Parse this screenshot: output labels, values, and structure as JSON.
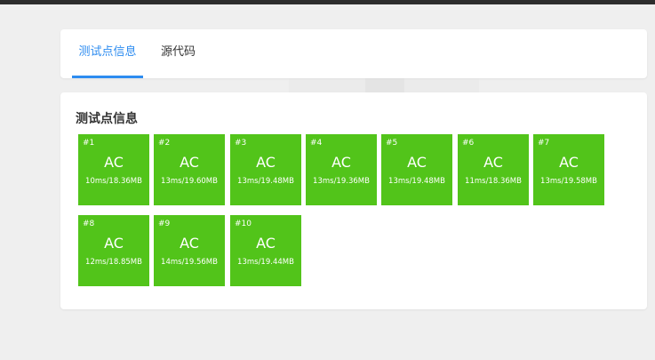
{
  "tabs": [
    {
      "label": "测试点信息",
      "active": true
    },
    {
      "label": "源代码",
      "active": false
    }
  ],
  "section": {
    "title": "测试点信息"
  },
  "accent_color": "#2d8cf0",
  "status_color": "#52c41a",
  "test_cases": [
    {
      "id": "#1",
      "status": "AC",
      "stats": "10ms/18.36MB"
    },
    {
      "id": "#2",
      "status": "AC",
      "stats": "13ms/19.60MB"
    },
    {
      "id": "#3",
      "status": "AC",
      "stats": "13ms/19.48MB"
    },
    {
      "id": "#4",
      "status": "AC",
      "stats": "13ms/19.36MB"
    },
    {
      "id": "#5",
      "status": "AC",
      "stats": "13ms/19.48MB"
    },
    {
      "id": "#6",
      "status": "AC",
      "stats": "11ms/18.36MB"
    },
    {
      "id": "#7",
      "status": "AC",
      "stats": "13ms/19.58MB"
    },
    {
      "id": "#8",
      "status": "AC",
      "stats": "12ms/18.85MB"
    },
    {
      "id": "#9",
      "status": "AC",
      "stats": "14ms/19.56MB"
    },
    {
      "id": "#10",
      "status": "AC",
      "stats": "13ms/19.44MB"
    }
  ]
}
